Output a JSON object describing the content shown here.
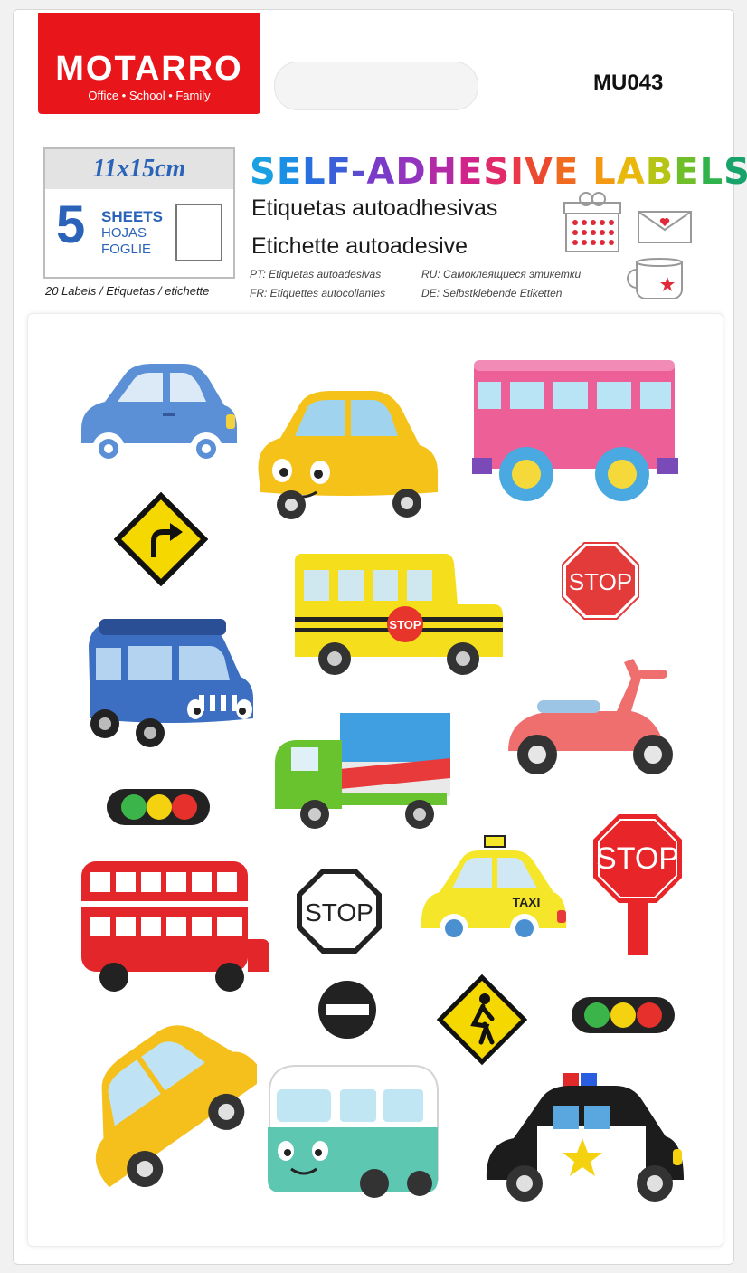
{
  "brand": {
    "name": "MOTARRO",
    "registered": "®",
    "tagline": "Office • School • Family"
  },
  "product_code": "MU043",
  "size_box": {
    "size": "11x15cm",
    "count": "5",
    "sheets": "SHEETS",
    "hojas": "HOJAS",
    "foglie": "FOGLIE"
  },
  "labels_count": "20 Labels / Etiquetas / etichette",
  "title": {
    "letters": [
      {
        "t": "S",
        "c": "#1aa0e0"
      },
      {
        "t": "E",
        "c": "#1b8fe3"
      },
      {
        "t": "L",
        "c": "#2a6fe0"
      },
      {
        "t": "F",
        "c": "#3b5fd8"
      },
      {
        "t": "-",
        "c": "#5b4bd0"
      },
      {
        "t": "A",
        "c": "#7a3bc8"
      },
      {
        "t": "D",
        "c": "#9334bf"
      },
      {
        "t": "H",
        "c": "#b22aa5"
      },
      {
        "t": "E",
        "c": "#d1248a"
      },
      {
        "t": "S",
        "c": "#e02a6a"
      },
      {
        "t": "I",
        "c": "#e8384a"
      },
      {
        "t": "V",
        "c": "#ec4a30"
      },
      {
        "t": "E",
        "c": "#f06a1f"
      },
      {
        "t": " ",
        "c": "#000"
      },
      {
        "t": "L",
        "c": "#f39a12"
      },
      {
        "t": "A",
        "c": "#e9b80c"
      },
      {
        "t": "B",
        "c": "#b6c515"
      },
      {
        "t": "E",
        "c": "#6fbf2a"
      },
      {
        "t": "L",
        "c": "#2fb34a"
      },
      {
        "t": "S",
        "c": "#17a36a"
      }
    ]
  },
  "subtitle_es": "Etiquetas autoadhesivas",
  "subtitle_it": "Etichette autoadesive",
  "languages": {
    "pt": "PT: Etiquetas autoadesivas",
    "fr": "FR: Etiquettes autocollantes",
    "ru": "RU: Самоклеящиеся этикетки",
    "de": "DE: Selbstklebende Etiketten"
  },
  "signs": {
    "stop": "STOP",
    "taxi": "TAXI"
  },
  "colors": {
    "brand_red": "#e8161b",
    "accent_blue": "#2a63b8"
  }
}
